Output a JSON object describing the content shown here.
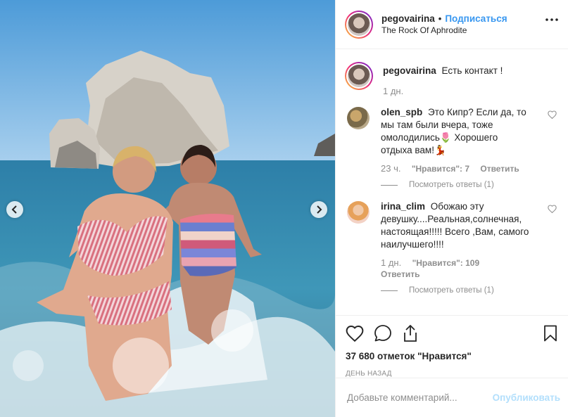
{
  "post": {
    "author": "pegovairina",
    "follow_label": "Подписаться",
    "separator": "•",
    "location": "The Rock Of Aphrodite"
  },
  "caption": {
    "username": "pegovairina",
    "text": "Есть контакт !",
    "time": "1 дн."
  },
  "comments": [
    {
      "username": "olen_spb",
      "text": "Это Кипр? Если да, то мы там были вчера, тоже омолодились🌷 Хорошего отдыха вам!💃",
      "time": "23 ч.",
      "likes": "\"Нравится\": 7",
      "reply": "Ответить",
      "view_replies": "Посмотреть ответы (1)"
    },
    {
      "username": "irina_clim",
      "text": "Обожаю эту девушку....Реальная,солнечная, настоящая!!!!! Всего ,Вам, самого наилучшего!!!!",
      "time": "1 дн.",
      "likes": "\"Нравится\": 109",
      "reply": "Ответить",
      "view_replies": "Посмотреть ответы (1)"
    }
  ],
  "likes_count": "37 680 отметок \"Нравится\"",
  "date": "ДЕНЬ НАЗАД",
  "add_comment": {
    "placeholder": "Добавьте комментарий...",
    "publish_label": "Опубликовать"
  },
  "icons": {
    "header_more": "more-icon",
    "like": "heart-icon",
    "comment": "comment-icon",
    "share": "share-icon",
    "save": "bookmark-icon",
    "prev": "chevron-left-icon",
    "next": "chevron-right-icon"
  },
  "colors": {
    "link": "#3897f0",
    "muted": "#8e8e8e",
    "publish_disabled": "#b2dffc",
    "text": "#262626"
  }
}
